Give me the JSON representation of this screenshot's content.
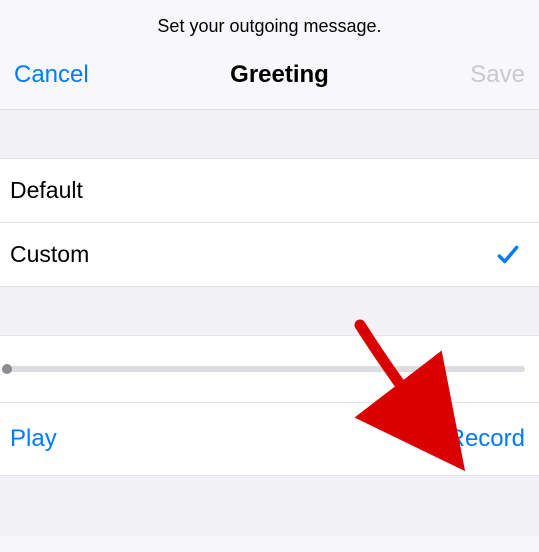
{
  "subtitle": "Set your outgoing message.",
  "navbar": {
    "cancel": "Cancel",
    "title": "Greeting",
    "save": "Save"
  },
  "options": {
    "default_label": "Default",
    "custom_label": "Custom",
    "selected": "custom"
  },
  "playback": {
    "position": 0
  },
  "actions": {
    "play": "Play",
    "record": "Record"
  },
  "accent_color": "#007aff"
}
